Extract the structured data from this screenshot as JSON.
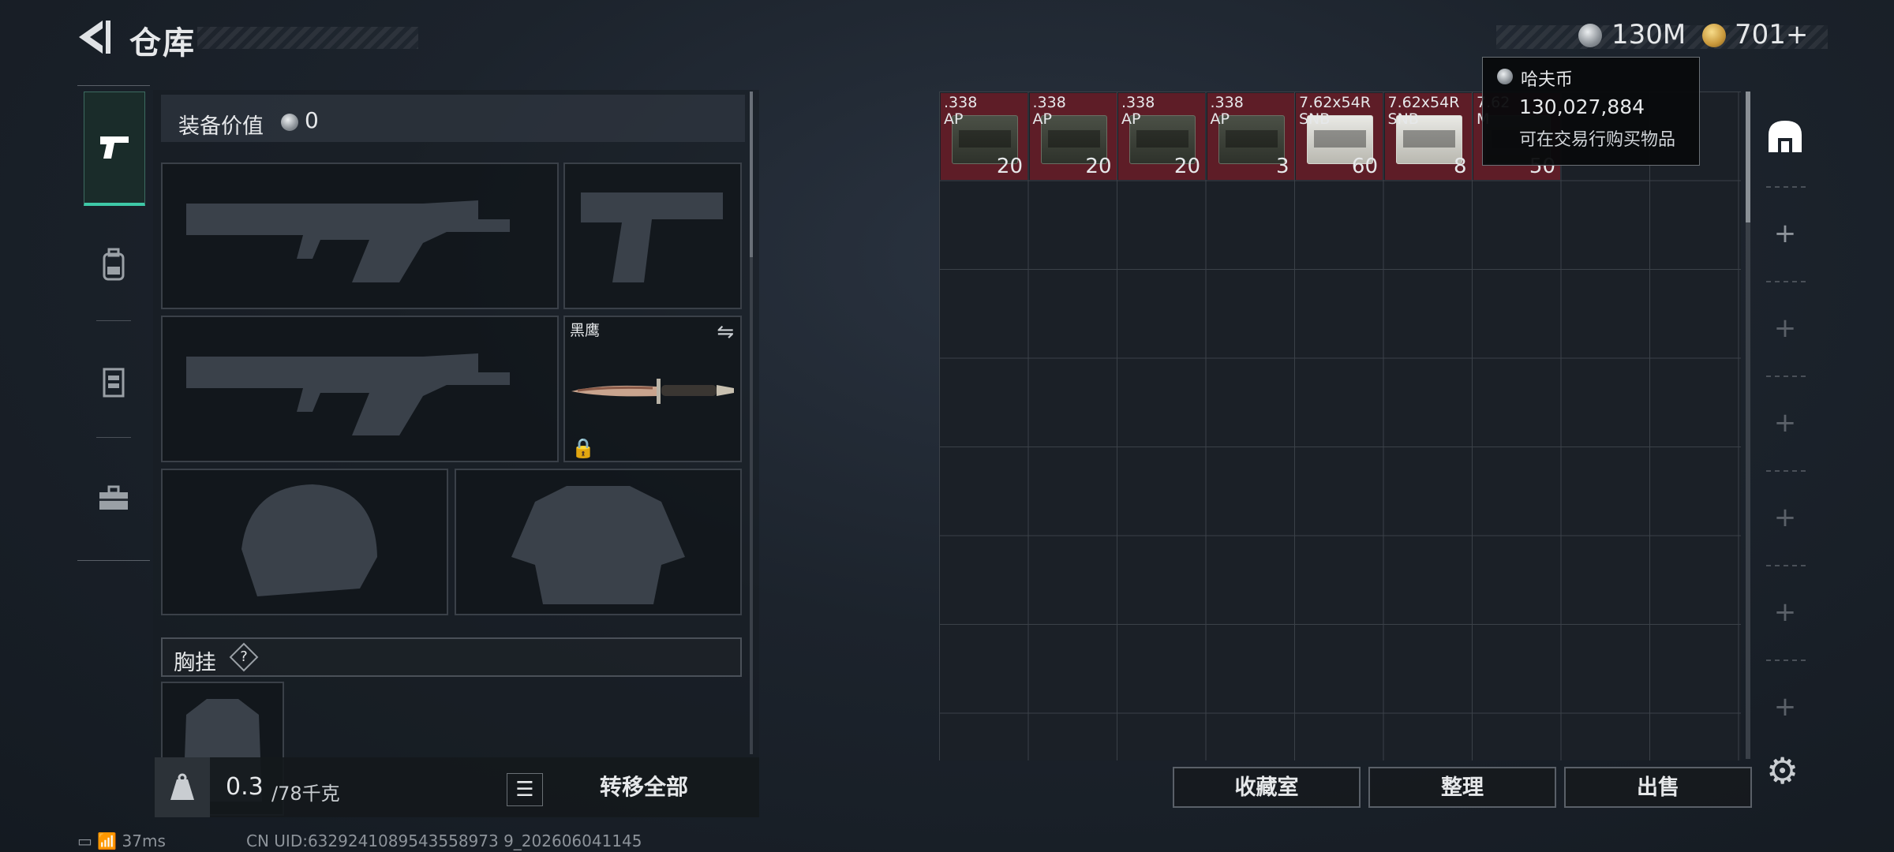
{
  "header": {
    "title": "仓库"
  },
  "currency": {
    "silver_value": "130M",
    "gold_value": "701+"
  },
  "tooltip": {
    "name": "哈夫币",
    "value": "130,027,884",
    "desc": "可在交易行购买物品"
  },
  "equipment": {
    "value_label": "装备价值",
    "value": "0",
    "melee_name": "黑鹰",
    "chest_label": "胸挂",
    "chest_help": "?"
  },
  "weight": {
    "current": "0.3",
    "max": "/78千克"
  },
  "left_actions": {
    "transfer_all": "转移全部"
  },
  "stash": {
    "items": [
      {
        "name": ".338\nAP",
        "count": "20",
        "style": "dark"
      },
      {
        "name": ".338\nAP",
        "count": "20",
        "style": "dark"
      },
      {
        "name": ".338\nAP",
        "count": "20",
        "style": "dark"
      },
      {
        "name": ".338\nAP",
        "count": "3",
        "style": "dark"
      },
      {
        "name": "7.62x54R\nSNB",
        "count": "60",
        "style": "white"
      },
      {
        "name": "7.62x54R\nSNB",
        "count": "8",
        "style": "white"
      },
      {
        "name": "7.62\nM",
        "count": "50",
        "style": "dark"
      }
    ]
  },
  "actions": {
    "collection": "收藏室",
    "organize": "整理",
    "sell": "出售"
  },
  "status": {
    "ping": "37ms",
    "uid": "CN UID:6329241089543558973 9_202606041145"
  }
}
